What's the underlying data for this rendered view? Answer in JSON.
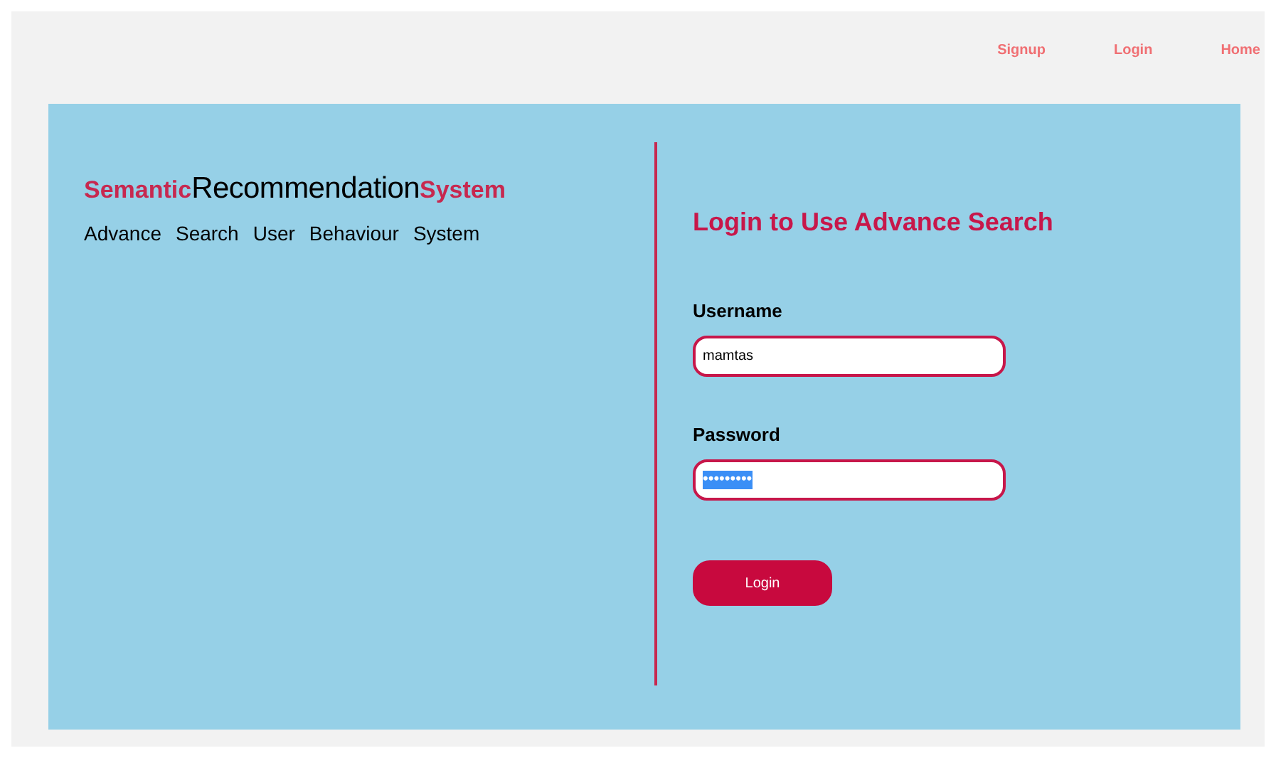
{
  "nav": [
    {
      "label": "Signup"
    },
    {
      "label": "Login"
    },
    {
      "label": "Home"
    }
  ],
  "brand": {
    "parts": [
      {
        "text": "Semantic",
        "kind": "accent"
      },
      {
        "text": "Recommendation",
        "kind": "main"
      },
      {
        "text": "System",
        "kind": "accent"
      }
    ]
  },
  "tagline": [
    "Advance",
    "Search",
    "User",
    "Behaviour",
    "System"
  ],
  "login_form": {
    "title": "Login to Use Advance Search",
    "fields": [
      {
        "label": "Username",
        "kind": "text",
        "value": "mamtas",
        "highlighted": false
      },
      {
        "label": "Password",
        "kind": "password",
        "value": "•••••••••",
        "highlighted": true
      }
    ],
    "submit": "Login"
  }
}
